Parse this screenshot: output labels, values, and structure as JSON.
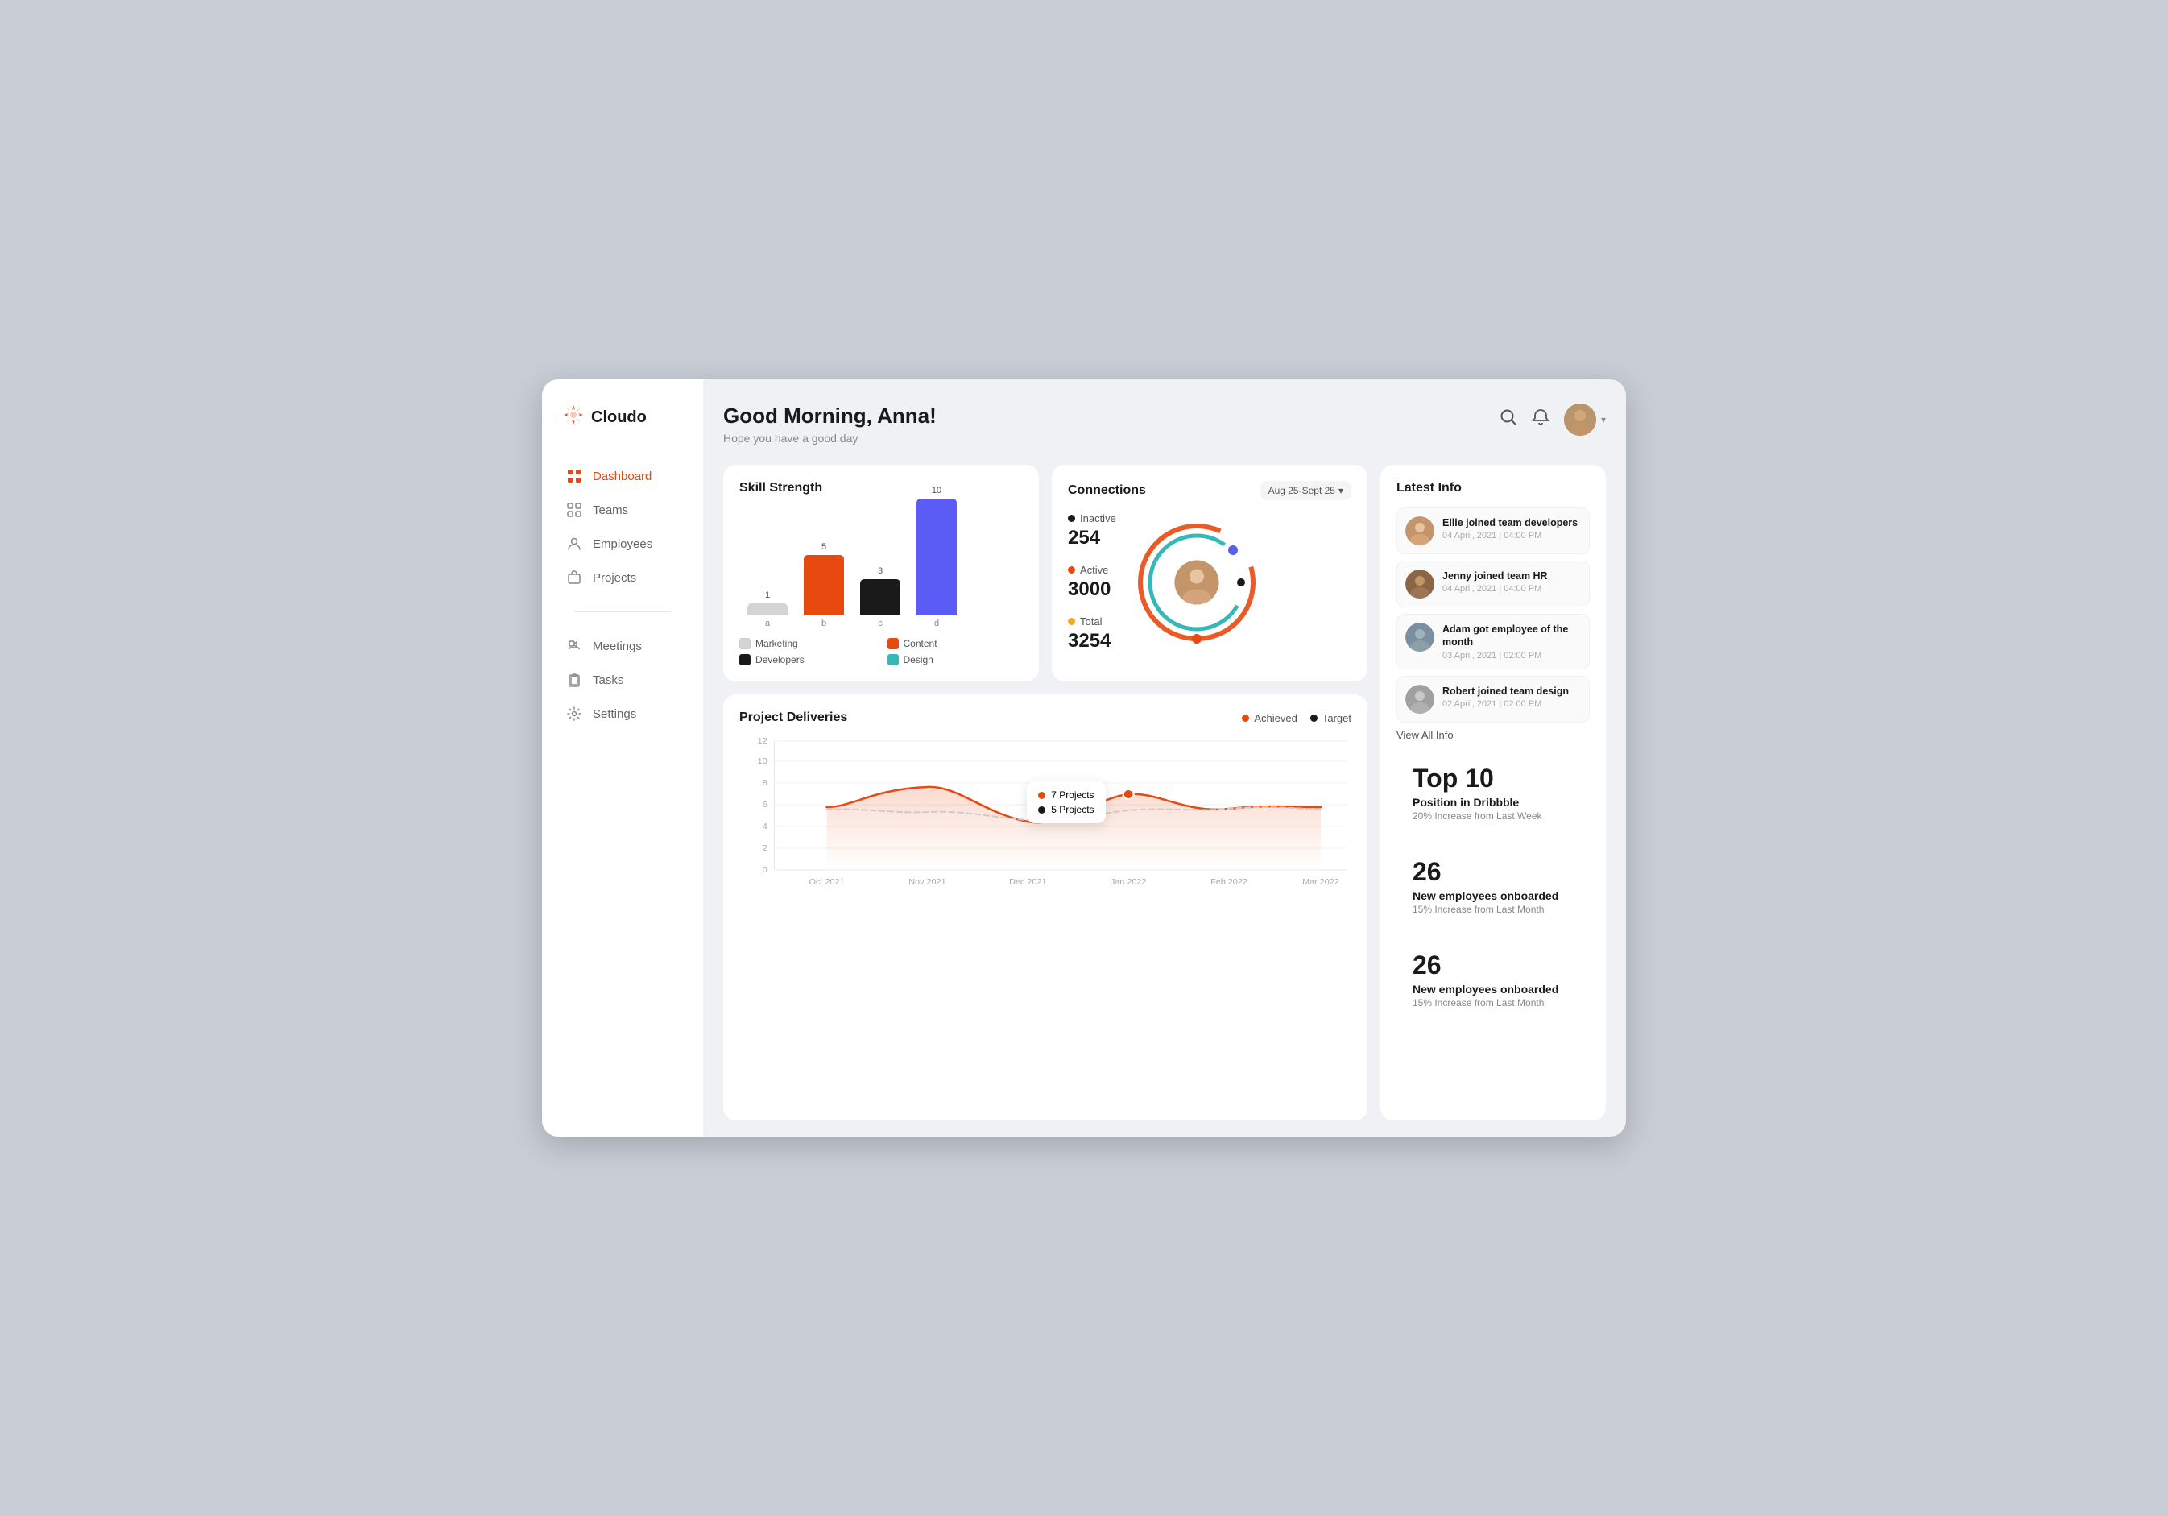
{
  "app": {
    "logo": "Cloudo",
    "logoIcon": "❊"
  },
  "sidebar": {
    "items": [
      {
        "id": "dashboard",
        "label": "Dashboard",
        "icon": "⊞",
        "active": true
      },
      {
        "id": "teams",
        "label": "Teams",
        "icon": "⊞",
        "active": false
      },
      {
        "id": "employees",
        "label": "Employees",
        "icon": "👤",
        "active": false
      },
      {
        "id": "projects",
        "label": "Projects",
        "icon": "💼",
        "active": false
      },
      {
        "id": "meetings",
        "label": "Meetings",
        "icon": "📞",
        "active": false
      },
      {
        "id": "tasks",
        "label": "Tasks",
        "icon": "📁",
        "active": false
      },
      {
        "id": "settings",
        "label": "Settings",
        "icon": "⚙",
        "active": false
      }
    ]
  },
  "header": {
    "greeting": "Good Morning, Anna!",
    "subtitle": "Hope you have a good day"
  },
  "skillStrength": {
    "title": "Skill Strength",
    "bars": [
      {
        "label": "a",
        "value": 1,
        "color": "#d4d4d4"
      },
      {
        "label": "b",
        "value": 5,
        "color": "#E8490F"
      },
      {
        "label": "c",
        "value": 3,
        "color": "#1a1a1a"
      },
      {
        "label": "d",
        "value": 10,
        "color": "#5B5BF6"
      }
    ],
    "legend": [
      {
        "label": "Marketing",
        "color": "#d4d4d4",
        "key": "a"
      },
      {
        "label": "Content",
        "color": "#E8490F",
        "key": "b"
      },
      {
        "label": "Developers",
        "color": "#1a1a1a",
        "key": "c"
      },
      {
        "label": "Design",
        "color": "#36B8B8",
        "key": "d"
      }
    ]
  },
  "connections": {
    "title": "Connections",
    "dateRange": "Aug 25-Sept 25",
    "stats": [
      {
        "label": "Inactive",
        "value": "254",
        "color": "#1a1a1a"
      },
      {
        "label": "Active",
        "value": "3000",
        "color": "#E8490F"
      },
      {
        "label": "Total",
        "value": "3254",
        "color": "#F5A623"
      }
    ]
  },
  "latestInfo": {
    "title": "Latest Info",
    "items": [
      {
        "name": "Ellie joined team developers",
        "date": "04 April, 2021 | 04:00 PM",
        "avatarColor": "#C4956A"
      },
      {
        "name": "Jenny joined team HR",
        "date": "04 April, 2021 | 04:00 PM",
        "avatarColor": "#8B6545"
      },
      {
        "name": "Adam got employee of the month",
        "date": "03 April, 2021 | 02:00 PM",
        "avatarColor": "#7B8FA0"
      },
      {
        "name": "Robert joined team design",
        "date": "02 April, 2021 | 02:00 PM",
        "avatarColor": "#A0A0A0"
      }
    ],
    "viewAll": "View All Info"
  },
  "projectDeliveries": {
    "title": "Project Deliveries",
    "legend": [
      {
        "label": "Achieved",
        "color": "#E8490F"
      },
      {
        "label": "Target",
        "color": "#1a1a1a"
      }
    ],
    "tooltip": {
      "achieved": "7 Projects",
      "target": "5 Projects"
    },
    "xLabels": [
      "Oct 2021",
      "Nov 2021",
      "Dec 2021",
      "Jan 2022",
      "Feb 2022",
      "Mar 2022"
    ],
    "yLabels": [
      "0",
      "2",
      "4",
      "6",
      "8",
      "10",
      "12"
    ]
  },
  "topStats": [
    {
      "number": "Top 10",
      "label": "Position in Dribbble",
      "sublabel": "20% Increase from Last Week"
    },
    {
      "number": "26",
      "label": "New employees onboarded",
      "sublabel": "15% Increase from Last Month"
    },
    {
      "number": "26",
      "label": "New employees onboarded",
      "sublabel": "15% Increase from Last Month"
    }
  ]
}
